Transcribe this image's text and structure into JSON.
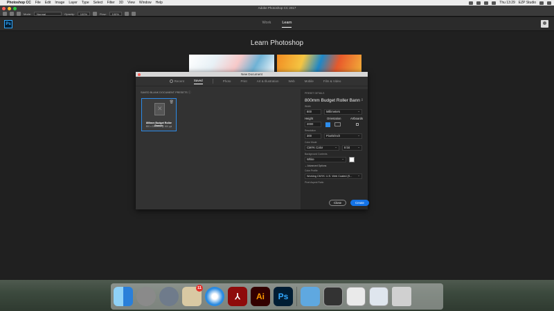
{
  "menubar": {
    "app_name": "Photoshop CC",
    "menus": [
      "File",
      "Edit",
      "Image",
      "Layer",
      "Type",
      "Select",
      "Filter",
      "3D",
      "View",
      "Window",
      "Help"
    ],
    "clock": "Thu 13:29",
    "user": "EZP Studio"
  },
  "psbar": {
    "window_title": "Adobe Photoshop CC 2017",
    "mode_label": "Mode:",
    "mode_value": "Normal",
    "opacity_label": "Opacity:",
    "opacity_value": "100%",
    "flow_label": "Flow:",
    "flow_value": "100%"
  },
  "start": {
    "logo": "Ps",
    "tabs": [
      "Work",
      "Learn"
    ],
    "active_tab": "Learn",
    "heading": "Learn Photoshop"
  },
  "dialog": {
    "title": "New Document",
    "tabs": [
      "Recent",
      "Saved",
      "Photo",
      "Print",
      "Art & Illustration",
      "Web",
      "Mobile",
      "Film & Video"
    ],
    "active_tab": "Saved",
    "presets_label": "SAVED BLANK DOCUMENT PRESETS",
    "preset": {
      "name": "800mm Budget Roller Banner",
      "size": "800 x 2000 mm @ 300 ppi"
    },
    "details": {
      "section_label": "PRESET DETAILS",
      "name": "800mm Budget Roller Bann",
      "width_label": "Width",
      "width_value": "800",
      "width_unit": "Millimeters",
      "height_label": "Height",
      "height_value": "2000",
      "orientation_label": "Orientation",
      "artboards_label": "Artboards",
      "resolution_label": "Resolution",
      "resolution_value": "300",
      "resolution_unit": "Pixels/Inch",
      "color_mode_label": "Color Mode",
      "color_mode_value": "CMYK Color",
      "bit_depth": "8 bit",
      "bg_label": "Background Contents",
      "bg_value": "White",
      "advanced_label": "Advanced Options",
      "profile_label": "Color Profile",
      "profile_value": "Working CMYK: U.S. Web Coated (S...",
      "aspect_label": "Pixel Aspect Ratio"
    },
    "close_label": "Close",
    "create_label": "Create"
  },
  "dock": {
    "mail_badge": "11",
    "illustrator_label": "Ai",
    "photoshop_label": "Ps"
  },
  "colors": {
    "accent": "#1473e6",
    "selection": "#2d8ceb",
    "ps_blue": "#31a8ff",
    "ai_orange": "#ff9a00"
  }
}
